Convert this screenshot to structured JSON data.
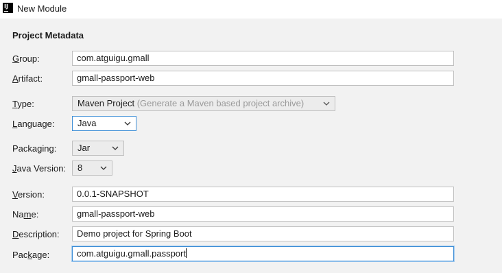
{
  "window": {
    "title": "New Module",
    "app_icon_text": "IJ"
  },
  "section": {
    "title": "Project Metadata"
  },
  "fields": {
    "group": {
      "label_u": "G",
      "label_rest": "roup:",
      "value": "com.atguigu.gmall"
    },
    "artifact": {
      "label_u": "A",
      "label_rest": "rtifact:",
      "value": "gmall-passport-web"
    },
    "type": {
      "label_u": "T",
      "label_rest": "ype:",
      "value": "Maven Project",
      "hint": "(Generate a Maven based project archive)"
    },
    "language": {
      "label_u": "L",
      "label_rest": "anguage:",
      "value": "Java"
    },
    "packaging": {
      "label_pre": "Packa",
      "label_u": "g",
      "label_rest": "ing:",
      "value": "Jar"
    },
    "java_version": {
      "label_u": "J",
      "label_rest": "ava Version:",
      "value": "8"
    },
    "version": {
      "label_u": "V",
      "label_rest": "ersion:",
      "value": "0.0.1-SNAPSHOT"
    },
    "name": {
      "label_pre": "Na",
      "label_u": "m",
      "label_rest": "e:",
      "value": "gmall-passport-web"
    },
    "description": {
      "label_u": "D",
      "label_rest": "escription:",
      "value": "Demo project for Spring Boot"
    },
    "package": {
      "label_pre": "Pac",
      "label_u": "k",
      "label_rest": "age:",
      "value": "com.atguigu.gmall.passport"
    }
  },
  "icons": {
    "app": "intellij-icon",
    "dropdown": "chevron-down-icon"
  },
  "colors": {
    "focus_border": "#3c8dd6",
    "hint_text": "#9a9a9a",
    "background": "#f2f2f2"
  }
}
